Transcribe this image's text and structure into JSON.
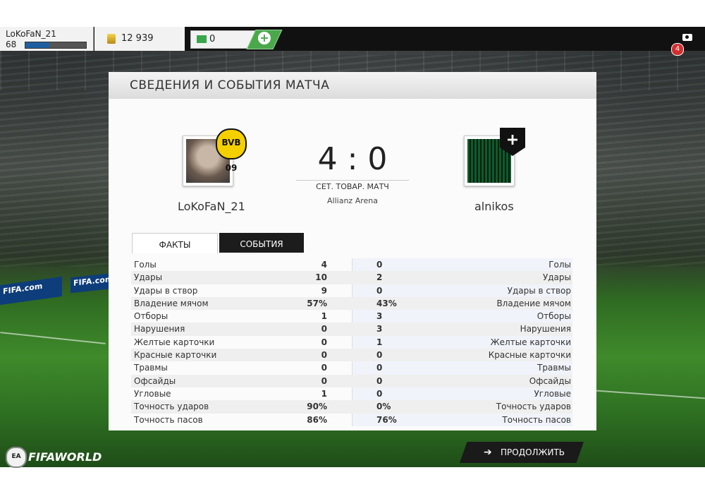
{
  "topbar": {
    "username": "LoKoFaN_21",
    "level": "68",
    "xp_progress": 0.4,
    "coins": "12 939",
    "points": "0",
    "add_label": "+",
    "notifications": "4"
  },
  "panel": {
    "title": "СВЕДЕНИЯ И СОБЫТИЯ МАТЧА",
    "home_name": "LoKoFaN_21",
    "away_name": "alnikos",
    "home_badge": "BVB 09",
    "score": "4 : 0",
    "match_type": "СЕТ. ТОВАР. МАТЧ",
    "stadium": "Allianz Arena",
    "tabs": [
      "ФАКТЫ",
      "СОБЫТИЯ"
    ]
  },
  "stats": [
    {
      "label": "Голы",
      "home": "4",
      "away": "0"
    },
    {
      "label": "Удары",
      "home": "10",
      "away": "2"
    },
    {
      "label": "Удары в створ",
      "home": "9",
      "away": "0"
    },
    {
      "label": "Владение мячом",
      "home": "57%",
      "away": "43%"
    },
    {
      "label": "Отборы",
      "home": "1",
      "away": "3"
    },
    {
      "label": "Нарушения",
      "home": "0",
      "away": "3"
    },
    {
      "label": "Желтые карточки",
      "home": "0",
      "away": "1"
    },
    {
      "label": "Красные карточки",
      "home": "0",
      "away": "0"
    },
    {
      "label": "Травмы",
      "home": "0",
      "away": "0"
    },
    {
      "label": "Офсайды",
      "home": "0",
      "away": "0"
    },
    {
      "label": "Угловые",
      "home": "1",
      "away": "0"
    },
    {
      "label": "Точность ударов",
      "home": "90%",
      "away": "0%"
    },
    {
      "label": "Точность пасов",
      "home": "86%",
      "away": "76%"
    }
  ],
  "footer": {
    "ea_label": "EA",
    "brand": "FIFAWORLD",
    "continue_label": "ПРОДОЛЖИТЬ"
  },
  "background_ads": [
    "FIFA.com",
    "FIFA.com"
  ]
}
